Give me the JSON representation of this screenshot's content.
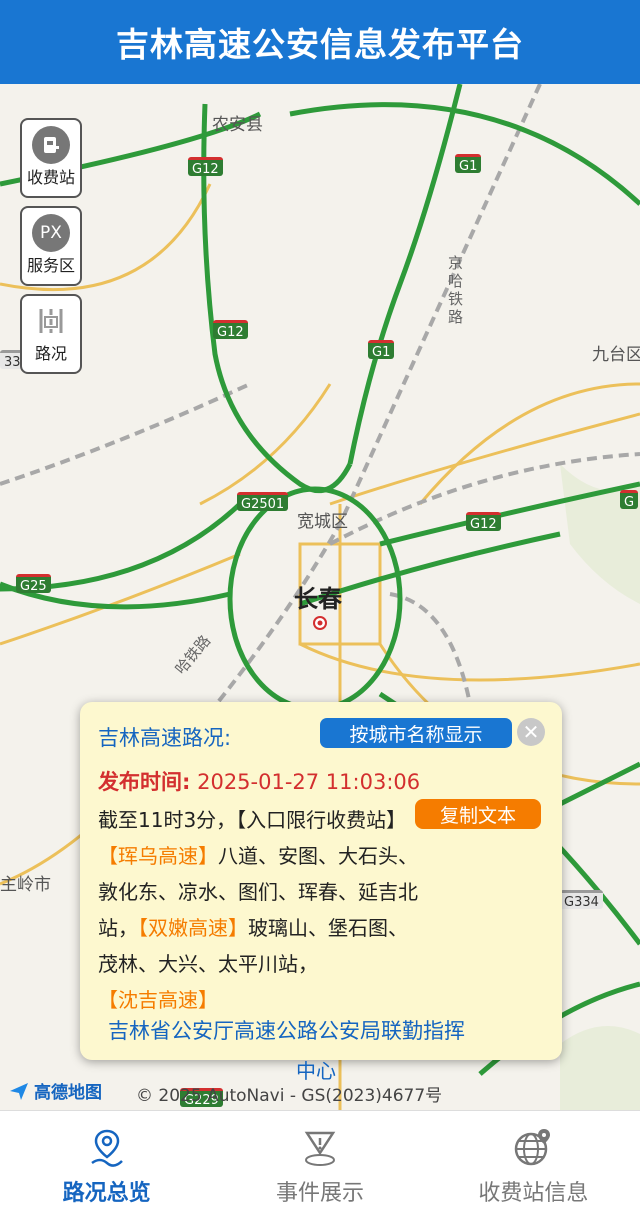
{
  "header": {
    "title": "吉林高速公安信息发布平台"
  },
  "map": {
    "labels": {
      "nongan": "农安县",
      "jiutai": "九台区",
      "kuancheng": "宽城区",
      "changchun": "长春",
      "zhulingshi": "主岭市",
      "jinghalu": "京哈铁路",
      "halu": "哈铁路"
    },
    "shields": {
      "g12_a": "G12",
      "g12_b": "G12",
      "g12_c": "G12",
      "g1_a": "G1",
      "g1_b": "G1",
      "g2501": "G2501",
      "g25": "G25",
      "g12_e": "G12",
      "g334": "G334",
      "g334_left": "334",
      "g229": "G229",
      "g_right": "G"
    },
    "colors": {
      "highway": "#2e9a3a",
      "arterial": "#e9b84a",
      "rail": "#9a9a9a"
    }
  },
  "side_buttons": {
    "toll": {
      "icon": "toll-station-icon",
      "label": "收费站"
    },
    "service": {
      "icon": "service-area-icon",
      "icon_text": "PX",
      "label": "服务区"
    },
    "traffic": {
      "icon": "road-condition-icon",
      "label": "路况"
    }
  },
  "popup": {
    "title": "吉林高速路况:",
    "city_button": "按城市名称显示",
    "close": "✕",
    "time_label": "发布时间:",
    "time_value": "2025-01-27 11:03:06",
    "copy_button": "复制文本",
    "body": {
      "p1": "截至11时3分，【入口限行收费站】",
      "hl1": "【珲乌高速】",
      "p2": "八道、安图、大石头、敦化东、凉水、图们、珲春、延吉北站，",
      "hl2": "【双嫩高速】",
      "p3": "玻璃山、堡石图、茂林、大兴、太平川站，",
      "hl3": "【沈吉高速】"
    },
    "footer": "吉林省公安厅高速公路公安局联勤指挥",
    "footer_overflow": "中心"
  },
  "attribution": {
    "logo_text": "高德地图",
    "copyright": "© 2025 AutoNavi - GS(2023)4677号"
  },
  "tabs": [
    {
      "label": "路况总览",
      "icon": "location-route-icon",
      "active": true
    },
    {
      "label": "事件展示",
      "icon": "warning-triangle-icon",
      "active": false
    },
    {
      "label": "收费站信息",
      "icon": "globe-location-icon",
      "active": false
    }
  ]
}
